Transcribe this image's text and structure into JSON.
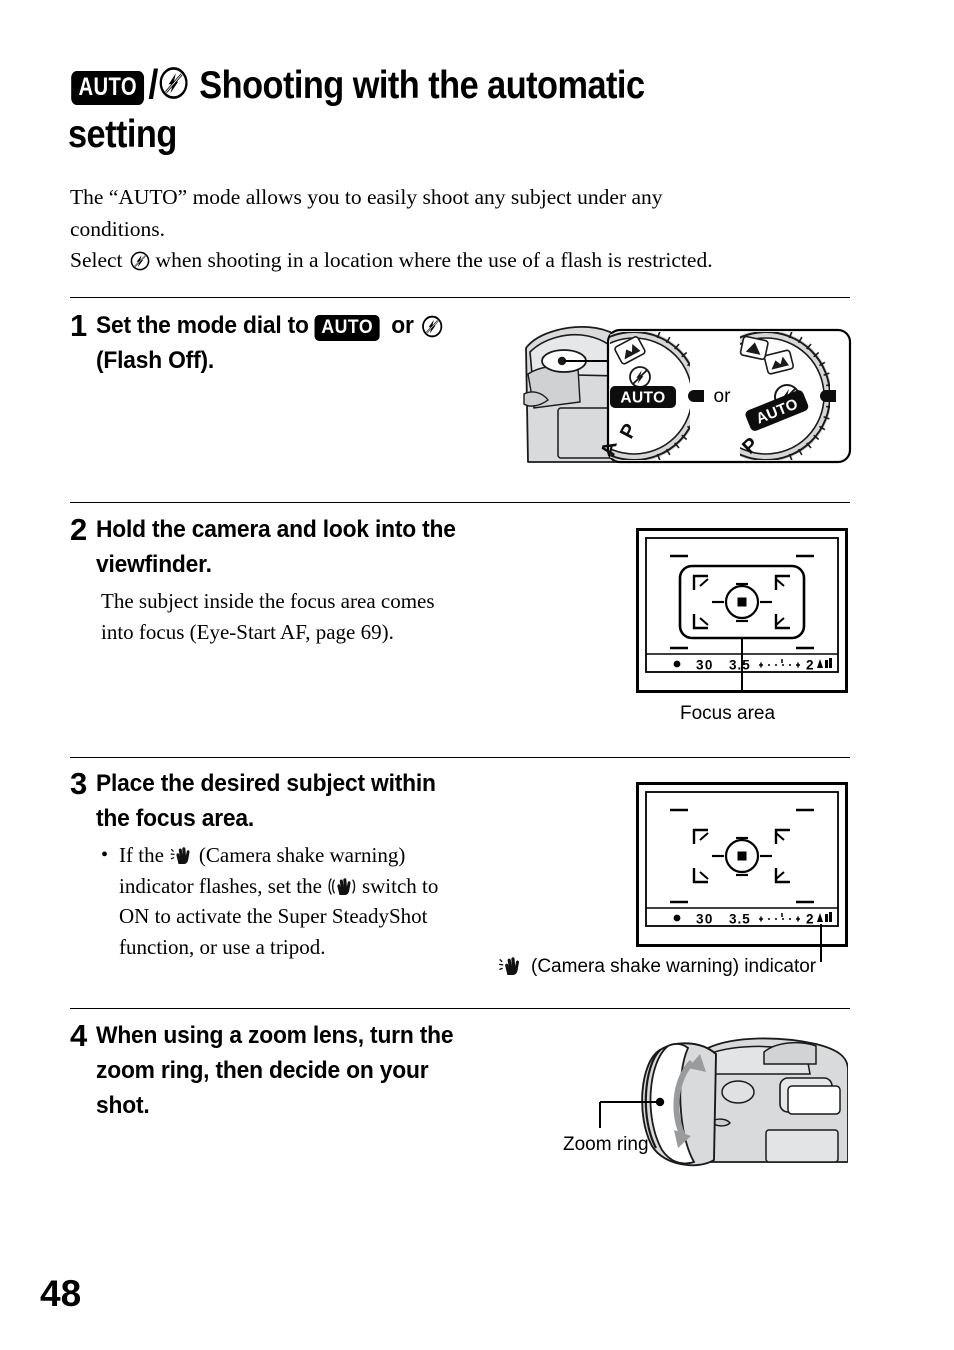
{
  "page": {
    "number": "48",
    "title": {
      "badge_auto": "AUTO",
      "separator": "/",
      "icon_flash_off": "flash-off-icon",
      "line1": "Shooting with the automatic",
      "line2": "setting"
    },
    "intro": {
      "line1": "The “AUTO” mode allows you to easily shoot any subject under any",
      "line2": "conditions.",
      "line3_before": "Select",
      "line3_icon": "flash-off-icon",
      "line3_after": "when shooting in a location where the use of a flash is restricted."
    },
    "steps": [
      {
        "number": "1",
        "title_part1": "Set the mode dial to",
        "title_badge": "AUTO",
        "title_part2": "or",
        "title_icon": "flash-off-icon",
        "title_line2": "(Flash Off).",
        "figure": {
          "name": "mode-dial-figure",
          "or_label": "or",
          "dial_left": {
            "selected": "AUTO",
            "labels": [
              "AUTO",
              "P",
              "A"
            ],
            "icons": [
              "landscape-icon",
              "flash-off-icon"
            ]
          },
          "dial_right": {
            "selected": "flash-off-icon",
            "labels": [
              "AUTO",
              "P"
            ],
            "icons": [
              "portrait-icon",
              "landscape-icon",
              "flash-off-icon"
            ]
          }
        }
      },
      {
        "number": "2",
        "title_line1": "Hold the camera and look into the",
        "title_line2": "viewfinder.",
        "body_line1": "The subject inside the focus area comes",
        "body_line2": "into focus (Eye-Start AF, page 69).",
        "figure": {
          "name": "viewfinder-focus-area-figure",
          "caption": "Focus area",
          "info_bar": {
            "focus_dot": "●",
            "shutter_speed": "30",
            "aperture": "3.5",
            "ev_scale": "-2..1..0..1..2+",
            "shots_remaining": "2"
          }
        }
      },
      {
        "number": "3",
        "title_line1": "Place the desired subject within",
        "title_line2": "the focus area.",
        "bullet": {
          "line1_before": "If the",
          "line1_icon": "camera-shake-icon",
          "line1_after": "(Camera shake warning)",
          "line2_before": "indicator flashes, set the",
          "line2_icon": "super-steadyshot-icon",
          "line2_after": "switch to",
          "line3": "ON to activate the Super SteadyShot",
          "line4": "function, or use a tripod."
        },
        "figure": {
          "name": "viewfinder-shake-indicator-figure",
          "caption_icon": "camera-shake-icon",
          "caption": "(Camera shake warning) indicator",
          "info_bar": {
            "focus_dot": "●",
            "shutter_speed": "30",
            "aperture": "3.5",
            "ev_scale": "-2..1..0..1..2+",
            "shots_remaining": "2"
          }
        }
      },
      {
        "number": "4",
        "title_line1": "When using a zoom lens, turn the",
        "title_line2": "zoom ring, then decide on your",
        "title_line3": "shot.",
        "figure": {
          "name": "zoom-ring-figure",
          "caption": "Zoom ring"
        }
      }
    ]
  }
}
